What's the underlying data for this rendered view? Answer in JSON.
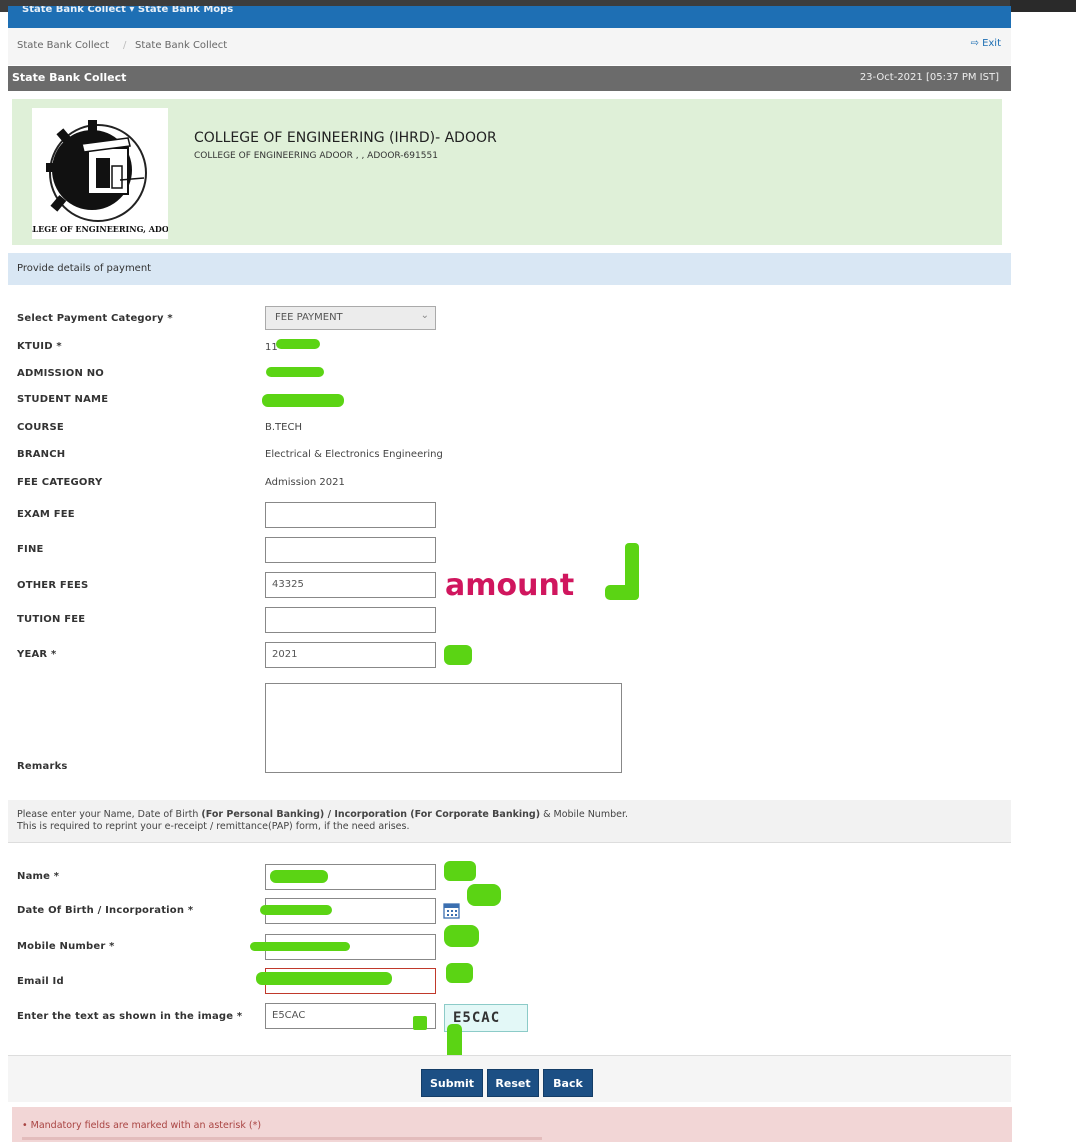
{
  "nav": {
    "title": "State Bank Collect ▾   State Bank Mops"
  },
  "breadcrumb": {
    "item1": "State Bank Collect",
    "separator": "/",
    "item2": "State Bank Collect",
    "exit": "Exit"
  },
  "titlebar": {
    "title": "State Bank Collect",
    "datetime": "23-Oct-2021 [05:37 PM IST]"
  },
  "institution": {
    "name": "COLLEGE OF ENGINEERING (IHRD)- ADOOR",
    "address": "COLLEGE OF ENGINEERING ADOOR , , ADOOR-691551",
    "logo_text": "*COLLEGE OF ENGINEERING, ADOOR*"
  },
  "info": "Provide details of payment",
  "form": {
    "payment_category": {
      "label": "Select Payment Category *",
      "value": "FEE PAYMENT"
    },
    "ktuid": {
      "label": "KTUID *",
      "value": "11"
    },
    "admission_no": {
      "label": "ADMISSION NO"
    },
    "student_name": {
      "label": "STUDENT NAME"
    },
    "course": {
      "label": "COURSE",
      "value": "B.TECH"
    },
    "branch": {
      "label": "BRANCH",
      "value": "Electrical & Electronics Engineering"
    },
    "fee_category": {
      "label": "FEE CATEGORY",
      "value": "Admission 2021"
    },
    "exam_fee": {
      "label": "EXAM FEE",
      "value": ""
    },
    "fine": {
      "label": "FINE",
      "value": ""
    },
    "other_fees": {
      "label": "OTHER FEES",
      "value": "43325"
    },
    "tution_fee": {
      "label": "TUTION FEE",
      "value": ""
    },
    "year": {
      "label": "YEAR *",
      "value": "2021"
    },
    "remarks": {
      "label": "Remarks"
    }
  },
  "note": {
    "line1_start": "Please enter your Name, Date of Birth ",
    "line1_bold1": "(For Personal Banking) / Incorporation (For Corporate Banking)",
    "line1_end": " & Mobile Number.",
    "line2": "This is required to reprint your e-receipt / remittance(PAP) form, if the need arises."
  },
  "personal": {
    "name": {
      "label": "Name *"
    },
    "dob": {
      "label": "Date Of Birth / Incorporation *"
    },
    "mobile": {
      "label": "Mobile Number *"
    },
    "email": {
      "label": "Email Id"
    },
    "captcha": {
      "label": "Enter the text as shown in the image *",
      "value": "E5CAC",
      "image_text": "E5CAC"
    }
  },
  "annotation": {
    "amount": "amount"
  },
  "buttons": {
    "submit": "Submit",
    "reset": "Reset",
    "back": "Back"
  },
  "mandatory": "•  Mandatory fields are marked with an asterisk (*)",
  "colors": {
    "nav_blue": "#1e6fb4",
    "button_blue": "#1c4f84",
    "header_green": "#dff0d8",
    "highlight_green": "#5bd414",
    "annotation_pink": "#d0165e"
  },
  "icons": {
    "exit": "exit-icon",
    "calendar": "calendar-icon",
    "select": "chevron-down-icon"
  }
}
